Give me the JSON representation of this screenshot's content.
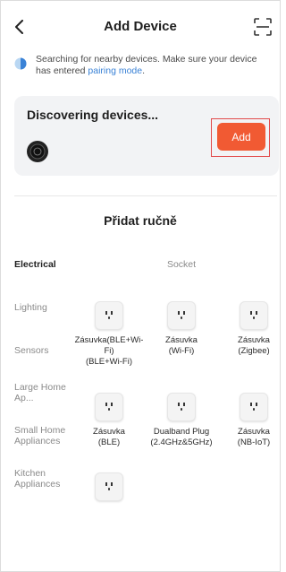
{
  "header": {
    "title": "Add Device",
    "back_icon": "chevron-left-icon",
    "scan_icon": "scan-icon"
  },
  "info": {
    "text": "Searching for nearby devices. Make sure your device has entered ",
    "link": "pairing mode",
    "suffix": "."
  },
  "discover": {
    "title": "Discovering devices...",
    "add_label": "Add"
  },
  "manual": {
    "title": "Přidat ručně"
  },
  "categories": [
    {
      "label": "Electrical",
      "active": true
    },
    {
      "label": "Lighting"
    },
    {
      "label": "Sensors"
    },
    {
      "label": "Large Home Ap..."
    },
    {
      "label": "Small Home Appliances"
    },
    {
      "label": "Kitchen Appliances"
    }
  ],
  "subcategory": "Socket",
  "devices": [
    {
      "label": "Zásuvka(BLE+Wi-Fi)\n(BLE+Wi-Fi)"
    },
    {
      "label": "Zásuvka\n(Wi-Fi)"
    },
    {
      "label": "Zásuvka\n(Zigbee)"
    },
    {
      "label": "Zásuvka\n(BLE)"
    },
    {
      "label": "Dualband Plug\n(2.4GHz&5GHz)"
    },
    {
      "label": "Zásuvka\n(NB-IoT)"
    },
    {
      "label": ""
    }
  ],
  "colors": {
    "accent": "#f15a33",
    "link": "#3a82d6",
    "highlight_outline": "#e24a4a"
  }
}
